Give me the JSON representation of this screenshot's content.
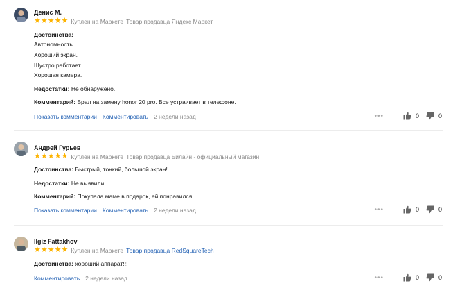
{
  "colors": {
    "star": "#fdb300",
    "link": "#2462b4",
    "muted": "#888888"
  },
  "icons": {
    "star": "star-icon",
    "like": "thumbs-up-icon",
    "dislike": "thumbs-down-icon",
    "more": "more-dots-icon"
  },
  "reviews": [
    {
      "author": "Денис М.",
      "rating": 5,
      "bought": "Куплен на Маркете",
      "seller": "Товар продавца Яндекс Маркет",
      "pros_label": "Достоинства:",
      "pros_lines": [
        "Автономность.",
        "Хороший экран.",
        "Шустро работает.",
        "Хорошая камера."
      ],
      "cons_label": "Недостатки:",
      "cons": "Не обнаружено.",
      "comment_label": "Комментарий:",
      "comment": "Брал на замену honor 20 pro. Все устраивает в телефоне.",
      "show_comments": "Показать комментарии",
      "add_comment": "Комментировать",
      "time": "2 недели назад",
      "likes": "0",
      "dislikes": "0"
    },
    {
      "author": "Андрей Гурьев",
      "rating": 5,
      "bought": "Куплен на Маркете",
      "seller": "Товар продавца Билайн - официальный магазин",
      "pros_label": "Достоинства:",
      "pros": "Быстрый, тонкий, большой экран!",
      "cons_label": "Недостатки:",
      "cons": "Не выявили",
      "comment_label": "Комментарий:",
      "comment": "Покупала маме в подарок, ей понравился.",
      "show_comments": "Показать комментарии",
      "add_comment": "Комментировать",
      "time": "2 недели назад",
      "likes": "0",
      "dislikes": "0"
    },
    {
      "author": "Ilgiz Fattakhov",
      "rating": 5,
      "bought": "Куплен на Маркете",
      "seller": "Товар продавца RedSquareTech",
      "pros_label": "Достоинства:",
      "pros": "хороший аппарат!!!",
      "add_comment": "Комментировать",
      "time": "2 недели назад",
      "likes": "0",
      "dislikes": "0"
    }
  ]
}
